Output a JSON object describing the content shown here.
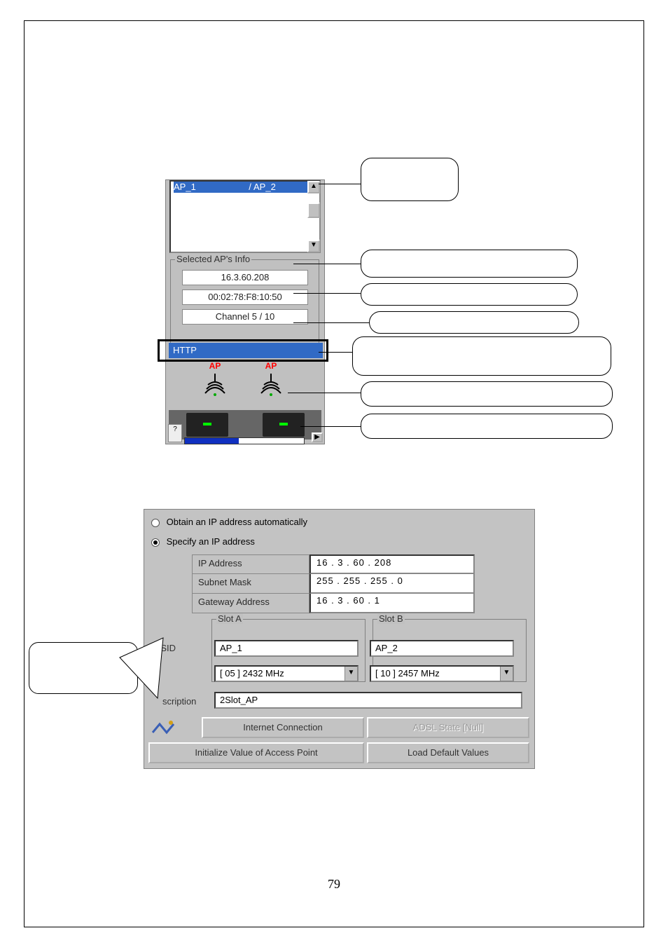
{
  "page_number": "79",
  "panel1": {
    "list": {
      "col1": "AP_1",
      "sep": "/",
      "col2": "AP_2"
    },
    "scroll_up": "▲",
    "scroll_down": "▼",
    "info_legend": "Selected AP's Info",
    "info_ip": "16.3.60.208",
    "info_mac": "00:02:78:F8:10:50",
    "info_channel": "Channel 5 / 10",
    "http_label": "HTTP",
    "ap_icon_label": "AP",
    "corner_q": "?",
    "arrow_r": "▶",
    "progress_percent": 45
  },
  "panel2": {
    "opt_obtain": "Obtain an IP address automatically",
    "opt_specify": "Specify an IP address",
    "ip_label": "IP Address",
    "ip_value": "16  .   3  .  60  . 208",
    "subnet_label": "Subnet Mask",
    "subnet_value": "255 . 255 . 255 .   0",
    "gw_label": "Gateway Address",
    "gw_value": "16  .   3  .  60  .   1",
    "slotA_legend": "Slot A",
    "slotB_legend": "Slot B",
    "essid_label": "ESSID",
    "slotA_essid": "AP_1",
    "slotB_essid": "AP_2",
    "slotA_channel": "[ 05 ] 2432 MHz",
    "slotB_channel": "[ 10 ] 2457 MHz",
    "desc_label": "scription",
    "desc_value": "2Slot_AP",
    "btn_internet": "Internet Connection",
    "btn_adsl": "ADSL State [Null]",
    "btn_init": "Initialize Value of Access Point",
    "btn_load": "Load Default Values",
    "dd_arrow": "▼"
  }
}
